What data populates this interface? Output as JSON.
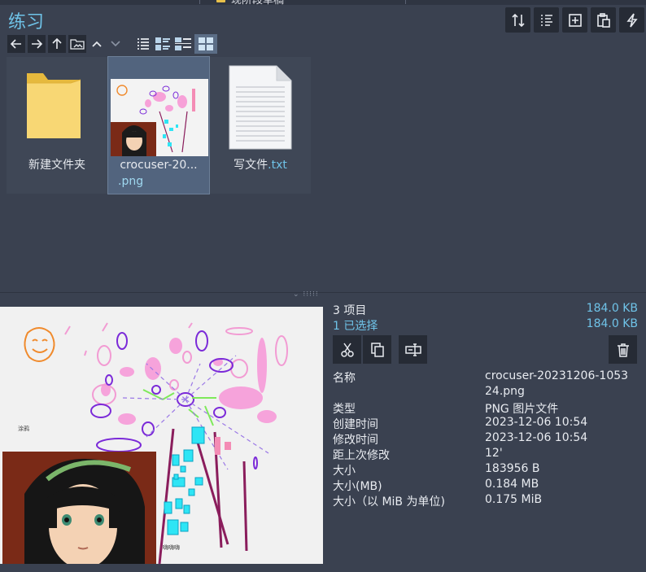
{
  "tab": {
    "title": "现阶段草稿"
  },
  "folder": {
    "title": "练习"
  },
  "toolbar_right": [
    {
      "name": "sort-icon"
    },
    {
      "name": "list-details-icon"
    },
    {
      "name": "new-item-icon"
    },
    {
      "name": "paste-icon"
    },
    {
      "name": "quick-action-icon"
    }
  ],
  "nav": {
    "icons": [
      "back-arrow-icon",
      "forward-arrow-icon",
      "up-arrow-icon",
      "folder-image-icon",
      "chevron-up-icon",
      "chevron-down-icon",
      "list-view-icon",
      "tiles-view-icon",
      "details-view-icon",
      "grid-view-icon"
    ],
    "selected_view": "grid-view-icon"
  },
  "files": [
    {
      "label": "新建文件夹",
      "type": "folder"
    },
    {
      "label_line1": "crocuser-20...",
      "label_line2": ".png",
      "type": "image",
      "selected": true
    },
    {
      "label_name": "写文件",
      "label_ext": ".txt",
      "type": "text"
    }
  ],
  "summary": {
    "items": "3 项目",
    "items_size": "184.0 KB",
    "selected": "1 已选择",
    "selected_size": "184.0 KB"
  },
  "actions": [
    "cut-icon",
    "copy-icon",
    "rename-icon",
    "delete-icon"
  ],
  "props": [
    {
      "k": "名称",
      "v": "crocuser-20231206-1053",
      "v2": "24.png"
    },
    {
      "k": "类型",
      "v": "PNG 图片文件"
    },
    {
      "k": "创建时间",
      "v": "2023-12-06  10:54"
    },
    {
      "k": "修改时间",
      "v": "2023-12-06  10:54"
    },
    {
      "k": "距上次修改",
      "v": "12'"
    },
    {
      "k": "大小",
      "v": "183956 B"
    },
    {
      "k": "大小(MB)",
      "v": "0.184 MB"
    },
    {
      "k": "大小（以 MiB 为单位)",
      "v": "0.175 MiB"
    }
  ],
  "preview": {
    "caption_small1": "涂鸦",
    "caption_small2": "嗨嗨嗨"
  },
  "colors": {
    "accent": "#6fc3e8",
    "bg": "#3a4150",
    "button": "#262b35",
    "selected": "#52647e"
  }
}
